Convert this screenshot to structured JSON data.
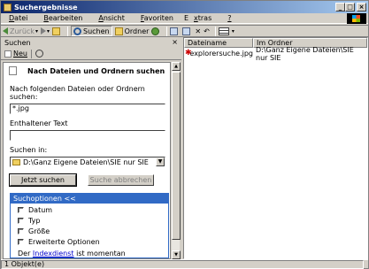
{
  "window": {
    "title": "Suchergebnisse"
  },
  "menu": {
    "items": [
      {
        "pre": "",
        "acc": "D",
        "post": "atei"
      },
      {
        "pre": "",
        "acc": "B",
        "post": "earbeiten"
      },
      {
        "pre": "",
        "acc": "A",
        "post": "nsicht"
      },
      {
        "pre": "",
        "acc": "F",
        "post": "avoriten"
      },
      {
        "pre": "E",
        "acc": "x",
        "post": "tras"
      },
      {
        "pre": "",
        "acc": "?",
        "post": ""
      }
    ]
  },
  "toolbar": {
    "back": "Zurück",
    "search": "Suchen",
    "folders": "Ordner"
  },
  "search_panel": {
    "header": "Suchen",
    "new": "Neu",
    "title": "Nach Dateien und Ordnern suchen",
    "filename_label": "Nach folgenden Dateien oder Ordnern suchen:",
    "filename_value": "*.jpg",
    "content_label": "Enthaltener Text",
    "content_value": "",
    "searchin_label": "Suchen in:",
    "searchin_value": "D:\\Ganz Eigene Dateien\\SIE nur SIE",
    "search_now": "Jetzt suchen",
    "stop_search": "Suche abbrechen",
    "options_header": "Suchoptionen <<",
    "options": [
      "Datum",
      "Typ",
      "Größe",
      "Erweiterte Optionen"
    ],
    "note_pre": "Der ",
    "note_link": "Indexdienst",
    "note_post": " ist momentan deaktiviert."
  },
  "results": {
    "columns": [
      "Dateiname",
      "Im Ordner"
    ],
    "rows": [
      {
        "name": "explorersuche.jpg",
        "folder": "D:\\Ganz Eigene Dateien\\SIE nur SIE"
      }
    ]
  },
  "status": {
    "text": "1 Objekt(e)"
  }
}
